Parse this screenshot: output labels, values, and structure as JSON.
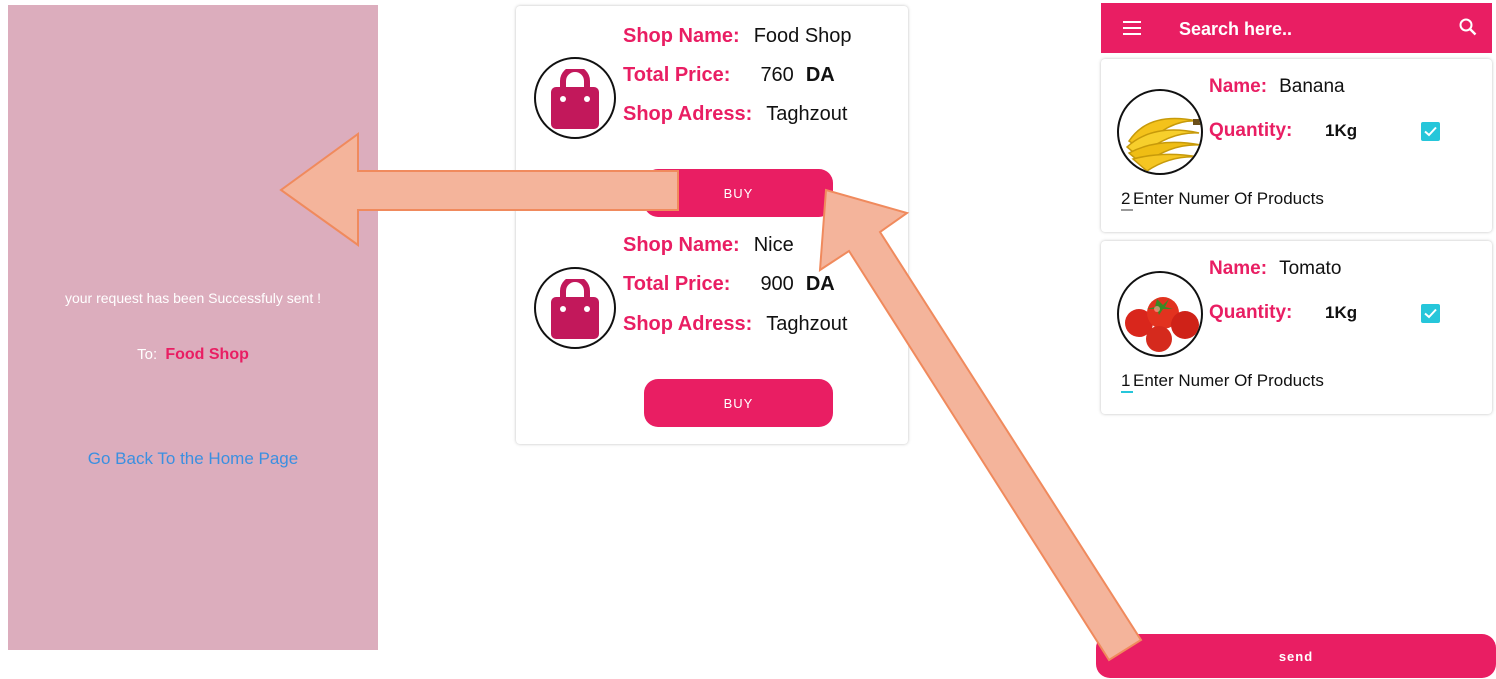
{
  "success": {
    "message": "your request has been Successfuly sent !",
    "to_label": "To:",
    "shop_name": "Food Shop",
    "home_link": "Go Back To the Home Page"
  },
  "shops": [
    {
      "name_label": "Shop Name:",
      "name": "Food Shop",
      "price_label": "Total Price:",
      "price": "760",
      "currency": "DA",
      "address_label": "Shop Adress:",
      "address": "Taghzout",
      "buy_label": "BUY"
    },
    {
      "name_label": "Shop Name:",
      "name": "Nice",
      "price_label": "Total Price:",
      "price": "900",
      "currency": "DA",
      "address_label": "Shop Adress:",
      "address": "Taghzout",
      "buy_label": "BUY"
    }
  ],
  "product_screen": {
    "search_placeholder": "Search here..",
    "products": [
      {
        "name_label": "Name:",
        "name": "Banana",
        "quantity_label": "Quantity:",
        "quantity": "1Kg",
        "checked": true,
        "count": "2",
        "count_label": "Enter Numer Of Products",
        "image": "banana"
      },
      {
        "name_label": "Name:",
        "name": "Tomato",
        "quantity_label": "Quantity:",
        "quantity": "1Kg",
        "checked": true,
        "count": "1",
        "count_label": "Enter Numer Of Products",
        "image": "tomato"
      }
    ],
    "send_label": "send"
  },
  "colors": {
    "accent": "#e91e63",
    "success_bg": "#dcadbd",
    "link": "#3b8fe0",
    "checkbox": "#26c6da",
    "arrow_fill": "#f4b49b",
    "arrow_stroke": "#f08a5d"
  },
  "icons": [
    "shopping-bag-icon",
    "menu-icon",
    "search-icon",
    "checkbox-checked-icon",
    "banana-image",
    "tomato-image"
  ]
}
